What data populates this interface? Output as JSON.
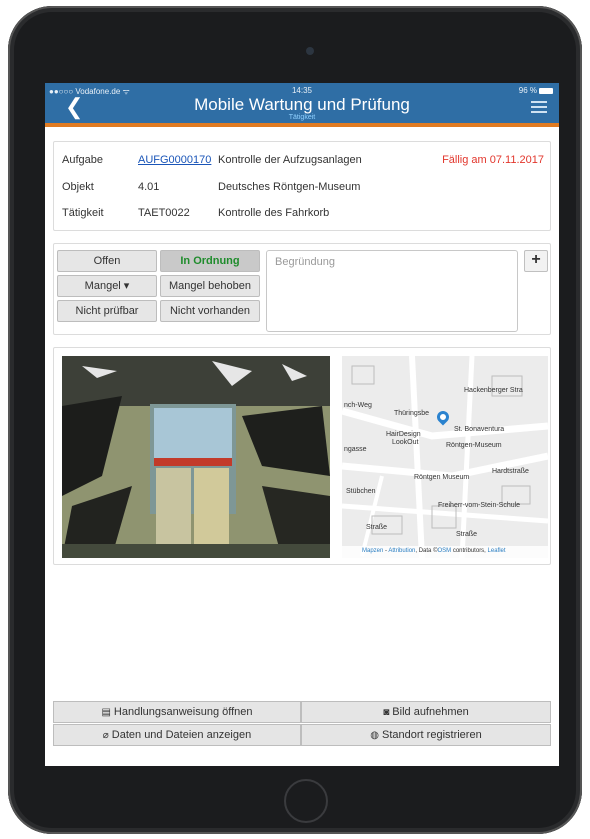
{
  "status_bar": {
    "carrier": "●●○○○ Vodafone.de ᯤ",
    "time": "14:35",
    "battery": "96 %"
  },
  "navbar": {
    "back_icon": "chevron-left-icon",
    "title": "Mobile Wartung und Prüfung",
    "subtitle": "Tätigkeit",
    "menu_icon": "hamburger-icon"
  },
  "info": {
    "rows": [
      {
        "label": "Aufgabe",
        "code": "AUFG0000170",
        "desc": "Kontrolle der Aufzugsanlagen"
      },
      {
        "label": "Objekt",
        "code": "4.01",
        "desc": "Deutsches Röntgen-Museum"
      },
      {
        "label": "Tätigkeit",
        "code": "TAET0022",
        "desc": "Kontrolle des Fahrkorb"
      }
    ],
    "due": "Fällig am  07.11.2017",
    "due_color": "#e2362c"
  },
  "status": {
    "buttons": [
      "Offen",
      "In Ordnung",
      "Mangel ▾",
      "Mangel behoben",
      "Nicht prüfbar",
      "Nicht vorhanden"
    ],
    "active": "In Ordnung",
    "reason_placeholder": "Begründung",
    "add_label": "+"
  },
  "map": {
    "labels": [
      "Hackenberger Stra",
      "Thüringsbe",
      "nch-Weg",
      "HairDesign",
      "LookOut",
      "St. Bonaventura",
      "Röntgen-Museum",
      "Röntgen Museum",
      "Hardtstraße",
      "Stübchen",
      "Freiherr-vom-Stein-Schule",
      "ngasse",
      "Straße",
      "Straße"
    ],
    "attribution": {
      "mapzen": "Mapzen",
      "sep": " - ",
      "attribution": "Attribution",
      "data": ", Data ©",
      "osm": "OSM",
      "contrib": " contributors, ",
      "leaflet": "Leaflet"
    }
  },
  "actions": [
    {
      "icon": "list-icon",
      "glyph": "▤",
      "label": "Handlungsanweisung öffnen"
    },
    {
      "icon": "camera-icon",
      "glyph": "◙",
      "label": "Bild aufnehmen"
    },
    {
      "icon": "paperclip-icon",
      "glyph": "⌀",
      "label": "Daten und Dateien anzeigen"
    },
    {
      "icon": "globe-icon",
      "glyph": "◍",
      "label": "Standort registrieren"
    }
  ],
  "colors": {
    "navbar": "#2f6ea5",
    "accent": "#e07b22",
    "ok_green": "#1f8c2c",
    "link": "#1a55b8"
  }
}
